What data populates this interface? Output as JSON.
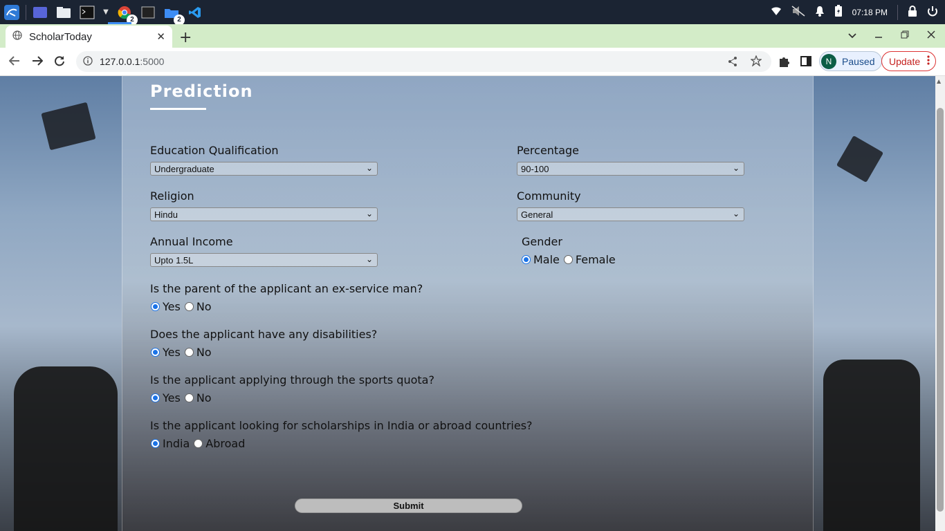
{
  "taskbar": {
    "chrome_badge": "2",
    "files_badge": "2",
    "time": "07:18 PM"
  },
  "browser": {
    "tab_title": "ScholarToday",
    "url_host": "127.0.0.1",
    "url_port": ":5000",
    "profile_initial": "N",
    "profile_status": "Paused",
    "update_label": "Update"
  },
  "form": {
    "title": "Prediction",
    "education": {
      "label": "Education Qualification",
      "value": "Undergraduate"
    },
    "percentage": {
      "label": "Percentage",
      "value": "90-100"
    },
    "religion": {
      "label": "Religion",
      "value": "Hindu"
    },
    "community": {
      "label": "Community",
      "value": "General"
    },
    "income": {
      "label": "Annual Income",
      "value": "Upto 1.5L"
    },
    "gender": {
      "label": "Gender",
      "options": [
        "Male",
        "Female"
      ],
      "selected": "Male"
    },
    "ex_service": {
      "label": "Is the parent of the applicant an ex-service man?",
      "options": [
        "Yes",
        "No"
      ],
      "selected": "Yes"
    },
    "disability": {
      "label": "Does the applicant have any disabilities?",
      "options": [
        "Yes",
        "No"
      ],
      "selected": "Yes"
    },
    "sports": {
      "label": "Is the applicant applying through the sports quota?",
      "options": [
        "Yes",
        "No"
      ],
      "selected": "Yes"
    },
    "location": {
      "label": "Is the applicant looking for scholarships in India or abroad countries?",
      "options": [
        "India",
        "Abroad"
      ],
      "selected": "India"
    },
    "submit_label": "Submit"
  },
  "colors": {
    "accent": "#1a73e8",
    "tabstrip": "#d3ecc8",
    "taskbar": "#1b2433"
  }
}
